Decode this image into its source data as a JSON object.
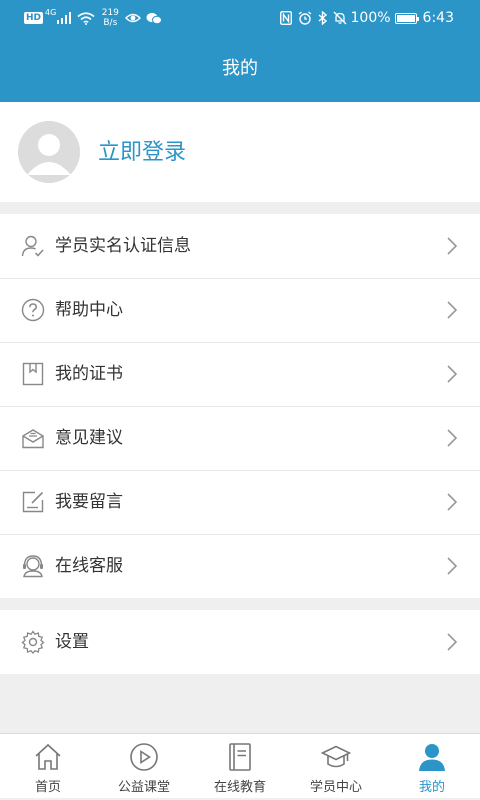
{
  "status_bar": {
    "hd": "HD",
    "network": "4G",
    "speed_value": "219",
    "speed_unit": "B/s",
    "battery_percent": "100%",
    "time": "6:43"
  },
  "header": {
    "title": "我的"
  },
  "profile": {
    "login_label": "立即登录"
  },
  "menu": {
    "items": [
      {
        "label": "学员实名认证信息",
        "icon": "user-check-icon"
      },
      {
        "label": "帮助中心",
        "icon": "question-circle-icon"
      },
      {
        "label": "我的证书",
        "icon": "certificate-icon"
      },
      {
        "label": "意见建议",
        "icon": "feedback-envelope-icon"
      },
      {
        "label": "我要留言",
        "icon": "edit-note-icon"
      },
      {
        "label": "在线客服",
        "icon": "headset-icon"
      }
    ],
    "settings": {
      "label": "设置",
      "icon": "gear-icon"
    }
  },
  "bottom_nav": {
    "items": [
      {
        "label": "首页",
        "icon": "home-icon"
      },
      {
        "label": "公益课堂",
        "icon": "play-circle-icon"
      },
      {
        "label": "在线教育",
        "icon": "book-icon"
      },
      {
        "label": "学员中心",
        "icon": "graduation-cap-icon"
      },
      {
        "label": "我的",
        "icon": "person-icon",
        "active": true
      }
    ]
  },
  "colors": {
    "primary": "#2b95c8",
    "background": "#efefef",
    "text": "#333333",
    "icon": "#888888"
  }
}
